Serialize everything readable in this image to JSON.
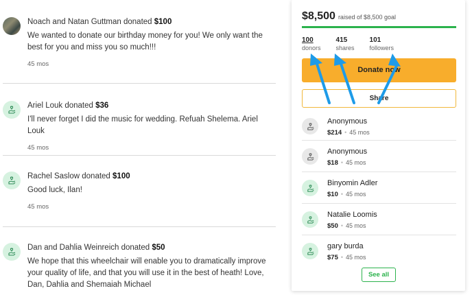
{
  "feed": [
    {
      "donor_text": "Noach and Natan Guttman donated ",
      "amount": "$100",
      "message": "We wanted to donate our birthday money for you! We only want the best for you and miss you so much!!!",
      "time": "45 mos",
      "avatar": "photo"
    },
    {
      "donor_text": "Ariel Louk donated ",
      "amount": "$36",
      "message": "I'll never forget I did the music for wedding. Refuah Shelema. Ariel Louk",
      "time": "45 mos",
      "avatar": "hand-heart-icon"
    },
    {
      "donor_text": "Rachel Saslow donated ",
      "amount": "$100",
      "message": "Good luck, Ilan!",
      "time": "45 mos",
      "avatar": "hand-heart-icon"
    },
    {
      "donor_text": "Dan and Dahlia Weinreich donated ",
      "amount": "$50",
      "message": "We hope that this wheelchair will enable you to dramatically improve your quality of life, and that you will use it in the best of heath! Love, Dan, Dahlia and Shemaiah Michael",
      "time": "",
      "avatar": "hand-heart-icon"
    }
  ],
  "sidebar": {
    "raised_amount": "$8,500",
    "raised_label": "raised of $8,500 goal",
    "progress_fraction": 1.0,
    "stats": [
      {
        "num": "100",
        "label": "donors"
      },
      {
        "num": "415",
        "label": "shares"
      },
      {
        "num": "101",
        "label": "followers"
      }
    ],
    "donate_label": "Donate now",
    "share_label": "Share",
    "donors": [
      {
        "name": "Anonymous",
        "amount": "$214",
        "time": "45 mos",
        "avatar": "anon"
      },
      {
        "name": "Anonymous",
        "amount": "$18",
        "time": "45 mos",
        "avatar": "anon"
      },
      {
        "name": "Binyomin Adler",
        "amount": "$10",
        "time": "45 mos",
        "avatar": "green"
      },
      {
        "name": "Natalie Loomis",
        "amount": "$50",
        "time": "45 mos",
        "avatar": "green"
      },
      {
        "name": "gary burda",
        "amount": "$75",
        "time": "45 mos",
        "avatar": "green"
      }
    ],
    "see_all_label": "See all"
  },
  "colors": {
    "accent_green": "#2bb24c",
    "donate_yellow": "#f8ad2c",
    "arrow_blue": "#1e9be8"
  }
}
